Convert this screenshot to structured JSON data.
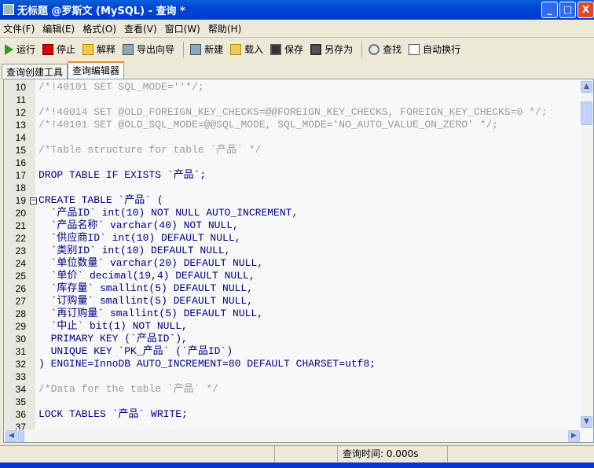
{
  "window": {
    "title": "无标题 @罗斯文 (MySQL) - 查询 *",
    "minimize": "_",
    "maximize": "□",
    "close": "X"
  },
  "menu": [
    "文件(F)",
    "编辑(E)",
    "格式(O)",
    "查看(V)",
    "窗口(W)",
    "帮助(H)"
  ],
  "toolbar": [
    {
      "label": "运行",
      "icon": "play-icon"
    },
    {
      "label": "停止",
      "icon": "stop-icon"
    },
    {
      "label": "解释",
      "icon": "explain-icon"
    },
    {
      "label": "导出向导",
      "icon": "export-icon"
    },
    {
      "label": "新建",
      "icon": "new-icon"
    },
    {
      "label": "载入",
      "icon": "folder-open-icon"
    },
    {
      "label": "保存",
      "icon": "save-icon"
    },
    {
      "label": "另存为",
      "icon": "save-as-icon"
    },
    {
      "label": "查找",
      "icon": "search-icon"
    },
    {
      "label": "自动换行",
      "icon": "word-wrap-icon"
    }
  ],
  "tabs": [
    {
      "label": "查询创建工具",
      "active": false
    },
    {
      "label": "查询编辑器",
      "active": true
    }
  ],
  "editor": {
    "lines": [
      {
        "n": "10",
        "kind": "comment",
        "text": "/*!40101 SET SQL_MODE=''*/;"
      },
      {
        "n": "11",
        "kind": "code",
        "text": ""
      },
      {
        "n": "12",
        "kind": "comment",
        "text": "/*!40014 SET @OLD_FOREIGN_KEY_CHECKS=@@FOREIGN_KEY_CHECKS, FOREIGN_KEY_CHECKS=0 */;"
      },
      {
        "n": "13",
        "kind": "comment",
        "text": "/*!40101 SET @OLD_SQL_MODE=@@SQL_MODE, SQL_MODE='NO_AUTO_VALUE_ON_ZERO' */;"
      },
      {
        "n": "14",
        "kind": "code",
        "text": ""
      },
      {
        "n": "15",
        "kind": "comment",
        "text": "/*Table structure for table `产品` */"
      },
      {
        "n": "16",
        "kind": "code",
        "text": ""
      },
      {
        "n": "17",
        "kind": "kw",
        "text": "DROP TABLE IF EXISTS `产品`;"
      },
      {
        "n": "18",
        "kind": "code",
        "text": ""
      },
      {
        "n": "19",
        "kind": "kw",
        "text": "CREATE TABLE `产品` ("
      },
      {
        "n": "20",
        "kind": "kw",
        "text": "  `产品ID` int(10) NOT NULL AUTO_INCREMENT,"
      },
      {
        "n": "21",
        "kind": "kw",
        "text": "  `产品名称` varchar(40) NOT NULL,"
      },
      {
        "n": "22",
        "kind": "kw",
        "text": "  `供应商ID` int(10) DEFAULT NULL,"
      },
      {
        "n": "23",
        "kind": "kw",
        "text": "  `类别ID` int(10) DEFAULT NULL,"
      },
      {
        "n": "24",
        "kind": "kw",
        "text": "  `单位数量` varchar(20) DEFAULT NULL,"
      },
      {
        "n": "25",
        "kind": "kw",
        "text": "  `单价` decimal(19,4) DEFAULT NULL,"
      },
      {
        "n": "26",
        "kind": "kw",
        "text": "  `库存量` smallint(5) DEFAULT NULL,"
      },
      {
        "n": "27",
        "kind": "kw",
        "text": "  `订购量` smallint(5) DEFAULT NULL,"
      },
      {
        "n": "28",
        "kind": "kw",
        "text": "  `再订购量` smallint(5) DEFAULT NULL,"
      },
      {
        "n": "29",
        "kind": "kw",
        "text": "  `中止` bit(1) NOT NULL,"
      },
      {
        "n": "30",
        "kind": "kw",
        "text": "  PRIMARY KEY (`产品ID`),"
      },
      {
        "n": "31",
        "kind": "kw",
        "text": "  UNIQUE KEY `PK_产品` (`产品ID`)"
      },
      {
        "n": "32",
        "kind": "kw",
        "text": ") ENGINE=InnoDB AUTO_INCREMENT=80 DEFAULT CHARSET=utf8;"
      },
      {
        "n": "33",
        "kind": "code",
        "text": ""
      },
      {
        "n": "34",
        "kind": "comment",
        "text": "/*Data for the table `产品` */"
      },
      {
        "n": "35",
        "kind": "code",
        "text": ""
      },
      {
        "n": "36",
        "kind": "kw",
        "text": "LOCK TABLES `产品` WRITE;"
      },
      {
        "n": "37",
        "kind": "code",
        "text": ""
      }
    ]
  },
  "status": {
    "query_time": "查询时间: 0.000s"
  }
}
